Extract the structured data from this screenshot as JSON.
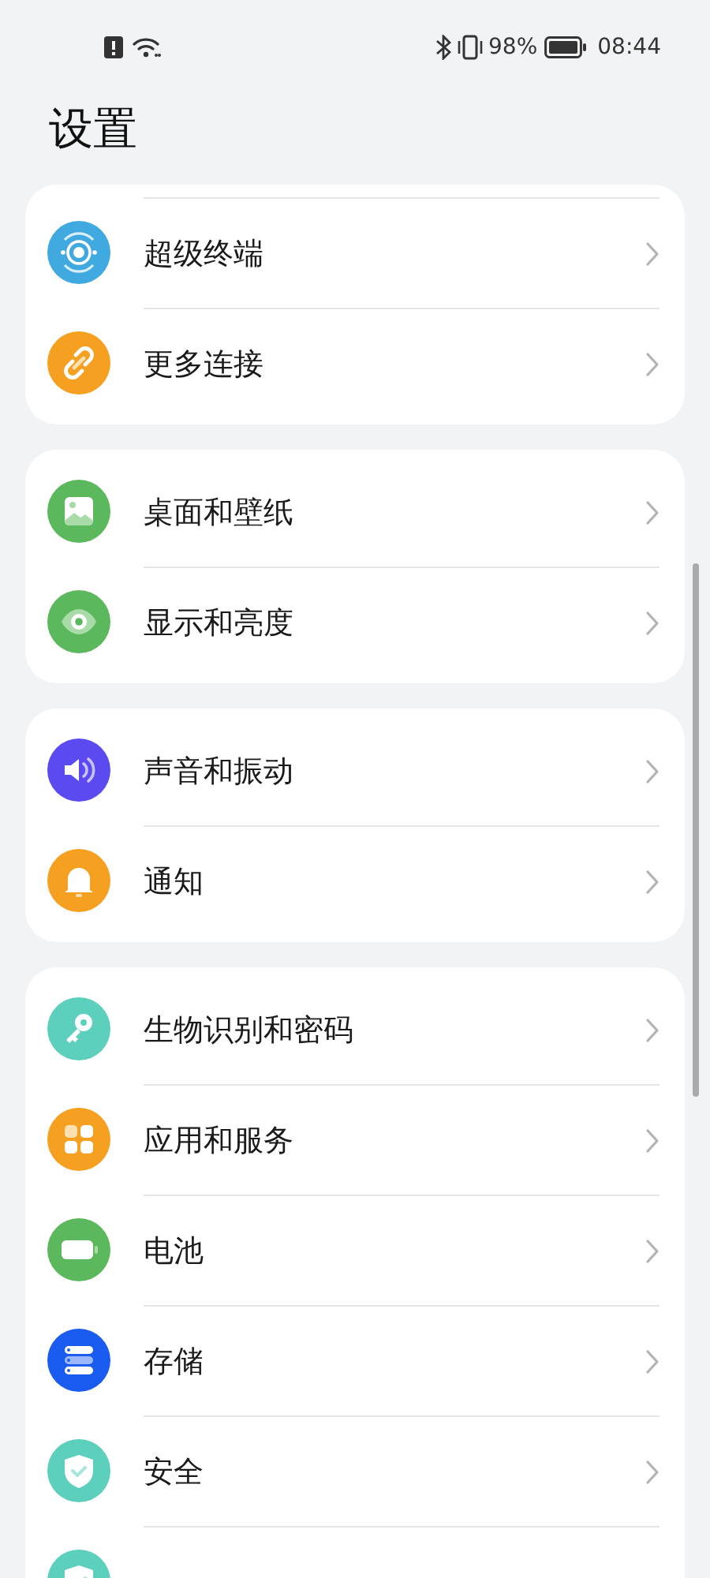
{
  "status_bar": {
    "battery_percent": "98%",
    "time": "08:44"
  },
  "title": "设置",
  "groups": [
    {
      "continues_above": true,
      "items": [
        {
          "label": "超级终端",
          "kind": "orbit",
          "color": "#3fa9e0"
        },
        {
          "label": "更多连接",
          "kind": "link",
          "color": "#f5a020"
        }
      ]
    },
    {
      "continues_above": false,
      "items": [
        {
          "label": "桌面和壁纸",
          "kind": "image",
          "color": "#5cb85c"
        },
        {
          "label": "显示和亮度",
          "kind": "eye",
          "color": "#5cb85c"
        }
      ]
    },
    {
      "continues_above": false,
      "items": [
        {
          "label": "声音和振动",
          "kind": "speaker",
          "color": "#5a4af0"
        },
        {
          "label": "通知",
          "kind": "bell",
          "color": "#f5a020"
        }
      ]
    },
    {
      "continues_above": false,
      "items": [
        {
          "label": "生物识别和密码",
          "kind": "key",
          "color": "#5ccfbd"
        },
        {
          "label": "应用和服务",
          "kind": "grid",
          "color": "#f5a020"
        },
        {
          "label": "电池",
          "kind": "battery",
          "color": "#5cb85c"
        },
        {
          "label": "存储",
          "kind": "storage",
          "color": "#1a5cf0"
        },
        {
          "label": "安全",
          "kind": "shield",
          "color": "#5ccfbd"
        },
        {
          "kind": "shield",
          "color": "#5ccfbd"
        }
      ]
    }
  ]
}
